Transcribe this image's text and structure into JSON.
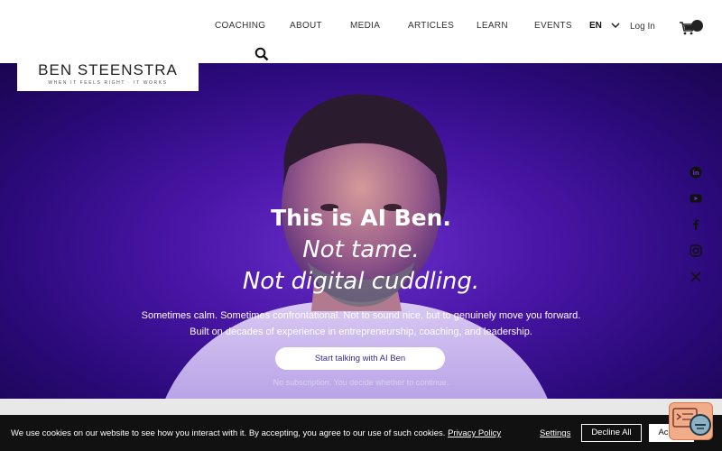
{
  "nav": {
    "items": [
      "COACHING",
      "ABOUT",
      "MEDIA",
      "ARTICLES",
      "LEARN",
      "EVENTS"
    ],
    "language": "EN",
    "login": "Log In"
  },
  "logo": {
    "title": "BEN STEENSTRA",
    "tagline": "WHEN IT FEELS RIGHT · IT WORKS"
  },
  "hero": {
    "headline": "This is AI Ben.",
    "line2": "Not tame.",
    "line3": "Not digital cuddling.",
    "para1": "Sometimes calm. Sometimes confrontational. Not to sound nice, but to genuinely move you forward.",
    "para2": "Built on decades of experience in entrepreneurship, coaching, and leadership.",
    "cta": "Start talking with AI Ben",
    "note": "No subscription. You decide whether to continue."
  },
  "social": [
    "linkedin-icon",
    "youtube-icon",
    "facebook-icon",
    "instagram-icon",
    "x-icon"
  ],
  "cookie": {
    "text": "We use cookies on our website to see how you interact with it. By accepting, you agree to our use of such cookies.",
    "policy": "Privacy Policy",
    "settings": "Settings",
    "decline": "Decline All",
    "accept": "Accept"
  },
  "colors": {
    "hero_purple": "#4a16a8",
    "cookie_bg": "#111111",
    "widget": "#f1ad8a"
  }
}
